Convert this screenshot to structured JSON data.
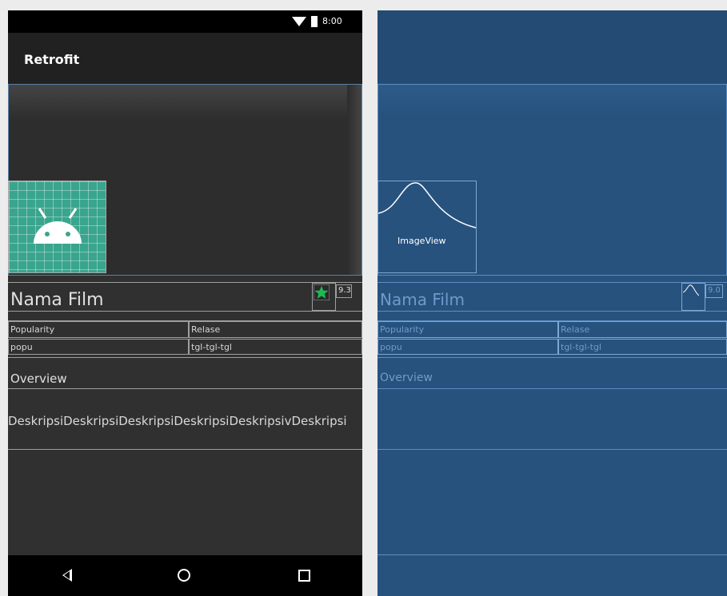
{
  "status_bar": {
    "time": "8:00"
  },
  "app_bar": {
    "title": "Retrofit"
  },
  "content": {
    "film_title": "Nama Film",
    "rating_value": "9.3",
    "popularity_label": "Popularity",
    "release_label": "Relase",
    "popularity_value": "popu",
    "release_value": "tgl-tgl-tgl",
    "overview_label": "Overview",
    "description": "DeskripsiDeskripsiDeskripsiDeskripsiDeskripsivDeskripsi"
  },
  "blueprint": {
    "image_label": "ImageView",
    "film_title": "Nama Film",
    "rating_value": "9.0",
    "popularity_label": "Popularity",
    "release_label": "Relase",
    "popularity_value": "popu",
    "release_value": "tgl-tgl-tgl",
    "overview_label": "Overview"
  },
  "nav_bar": {
    "back_icon": "back-triangle",
    "home_icon": "home-circle",
    "recents_icon": "recents-square"
  },
  "colors": {
    "design_bg": "#303030",
    "blueprint_bg": "#27527e",
    "accent_star": "#1db954"
  }
}
